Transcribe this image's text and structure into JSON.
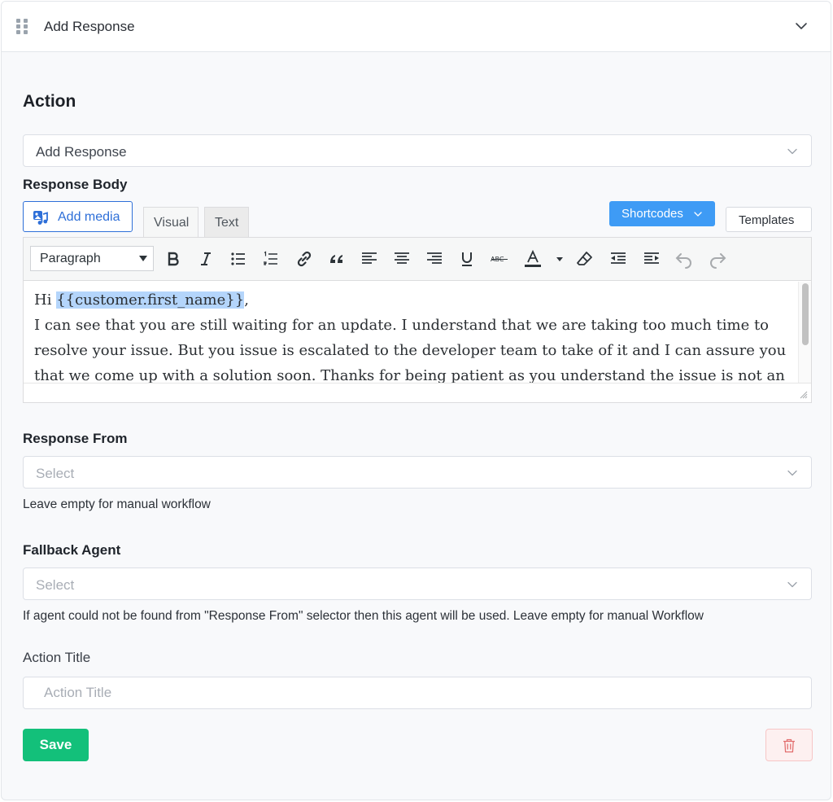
{
  "header": {
    "title": "Add Response"
  },
  "action": {
    "section_title": "Action",
    "selected": "Add Response"
  },
  "response_body": {
    "label": "Response Body",
    "add_media_label": "Add media",
    "tabs": {
      "visual": "Visual",
      "text": "Text"
    },
    "shortcodes_label": "Shortcodes",
    "templates_label": "Templates",
    "format_select": "Paragraph",
    "content": {
      "greeting_prefix": "Hi ",
      "placeholder_token": "{{customer.first_name}}",
      "greeting_suffix": ",",
      "body": "I can see that you are still waiting for an update. I understand that we are taking too much time to resolve your issue. But you issue is escalated to the developer team to take of it and I can assure you that we come up with a solution soon. Thanks for being patient as you understand the issue is not an"
    },
    "toolbar_icons": [
      "bold-icon",
      "italic-icon",
      "bullet-list-icon",
      "numbered-list-icon",
      "link-icon",
      "blockquote-icon",
      "align-left-icon",
      "align-center-icon",
      "align-right-icon",
      "underline-icon",
      "strikethrough-icon",
      "text-color-icon",
      "clear-format-icon",
      "outdent-icon",
      "indent-icon",
      "undo-icon",
      "redo-icon"
    ]
  },
  "response_from": {
    "label": "Response From",
    "placeholder": "Select",
    "help": "Leave empty for manual workflow"
  },
  "fallback_agent": {
    "label": "Fallback Agent",
    "placeholder": "Select",
    "help": "If agent could not be found from \"Response From\" selector then this agent will be used. Leave empty for manual Workflow"
  },
  "action_title": {
    "label": "Action Title",
    "placeholder": "Action Title",
    "value": ""
  },
  "buttons": {
    "save": "Save"
  },
  "colors": {
    "primary": "#3e9bf5",
    "save": "#13c07a",
    "delete_bg": "#fdf0f0",
    "delete_icon": "#e26d6d",
    "media_accent": "#2e6fd8",
    "highlight": "#b4d5fb"
  }
}
